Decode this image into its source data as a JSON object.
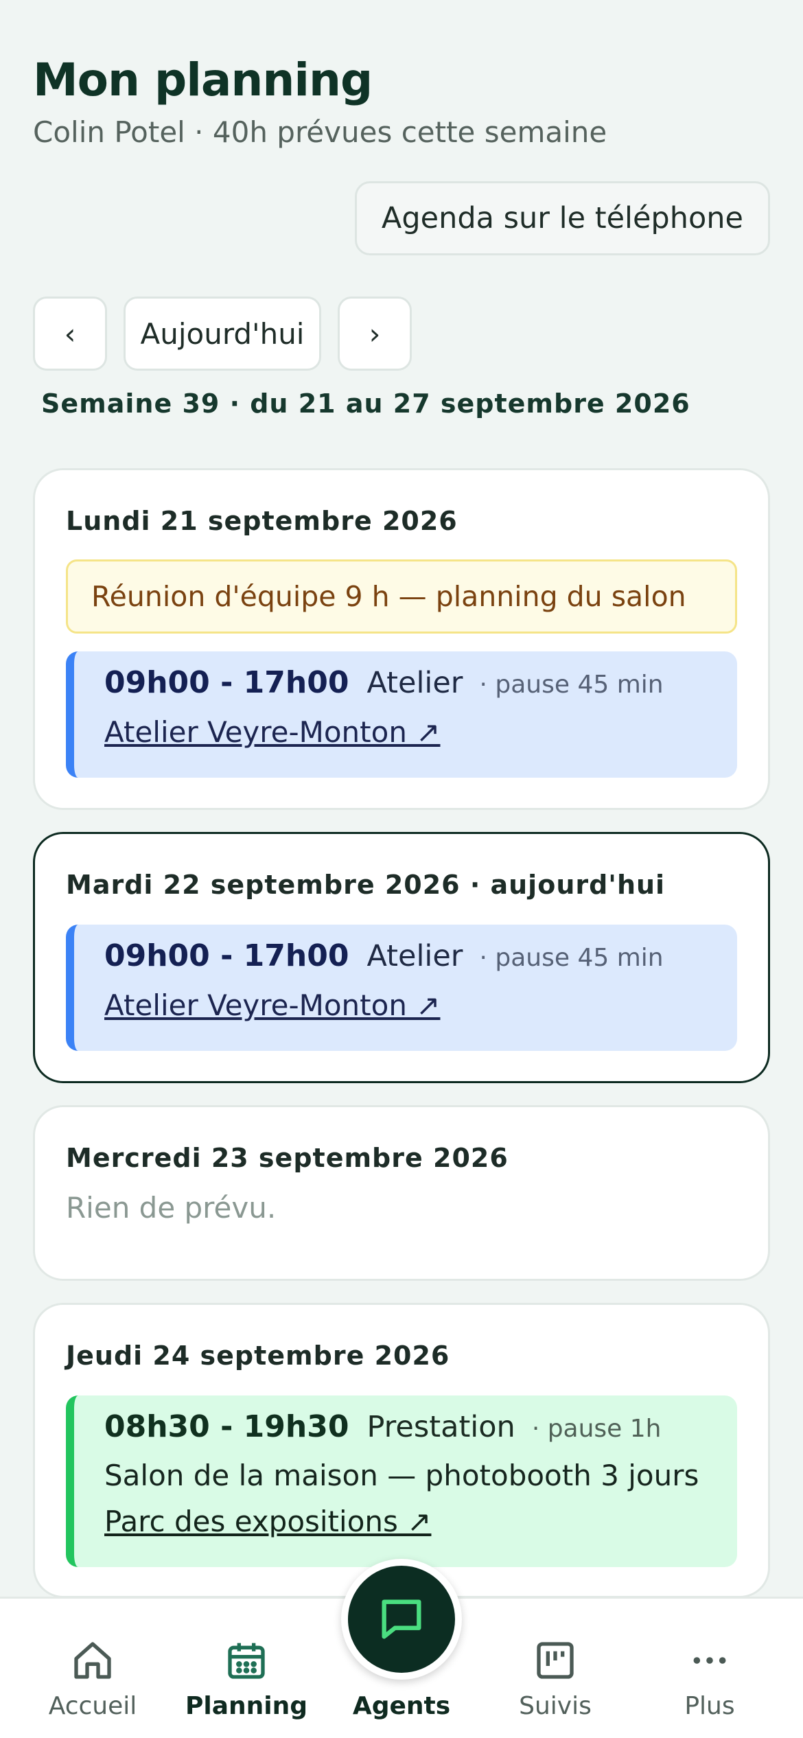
{
  "header": {
    "title": "Mon planning",
    "subtitle": "Colin Potel · 40h prévues cette semaine",
    "phone_agenda_label": "Agenda sur le téléphone"
  },
  "navigation": {
    "prev_label": "‹",
    "today_label": "Aujourd'hui",
    "next_label": "›",
    "week_label": "Semaine 39 · du 21 au 27 septembre 2026"
  },
  "days": [
    {
      "title": "Lundi 21 septembre 2026",
      "note": "Réunion d'équipe 9 h — planning du salon",
      "shift": {
        "time": "09h00 - 17h00",
        "type": "Atelier",
        "pause": "· pause 45 min",
        "location": "Atelier Veyre-Monton ↗",
        "color": "#3b82f6"
      }
    },
    {
      "title": "Mardi 22 septembre 2026 · aujourd'hui",
      "shift": {
        "time": "09h00 - 17h00",
        "type": "Atelier",
        "pause": "· pause 45 min",
        "location": "Atelier Veyre-Monton ↗",
        "color": "#3b82f6"
      }
    },
    {
      "title": "Mercredi 23 septembre 2026",
      "empty_text": "Rien de prévu."
    },
    {
      "title": "Jeudi 24 septembre 2026",
      "shift": {
        "time": "08h30 - 19h30",
        "type": "Prestation",
        "pause": "· pause 1h",
        "description": "Salon de la maison — photobooth 3 jours",
        "location": "Parc des expositions ↗",
        "color": "#22c55e"
      }
    }
  ],
  "bottom_nav": {
    "items": [
      {
        "label": "Accueil",
        "icon": "home-icon"
      },
      {
        "label": "Planning",
        "icon": "calendar-icon",
        "active": true
      },
      {
        "label": "Agents",
        "icon": "chat-bubble-icon"
      },
      {
        "label": "Suivis",
        "icon": "kanban-icon"
      },
      {
        "label": "Plus",
        "icon": "more-dots-icon"
      }
    ]
  },
  "colors": {
    "background": "#f0f5f3",
    "primary_dark": "#0c2d22",
    "accent_green": "#4ade80",
    "shift_blue": "#3b82f6",
    "shift_green": "#22c55e"
  }
}
